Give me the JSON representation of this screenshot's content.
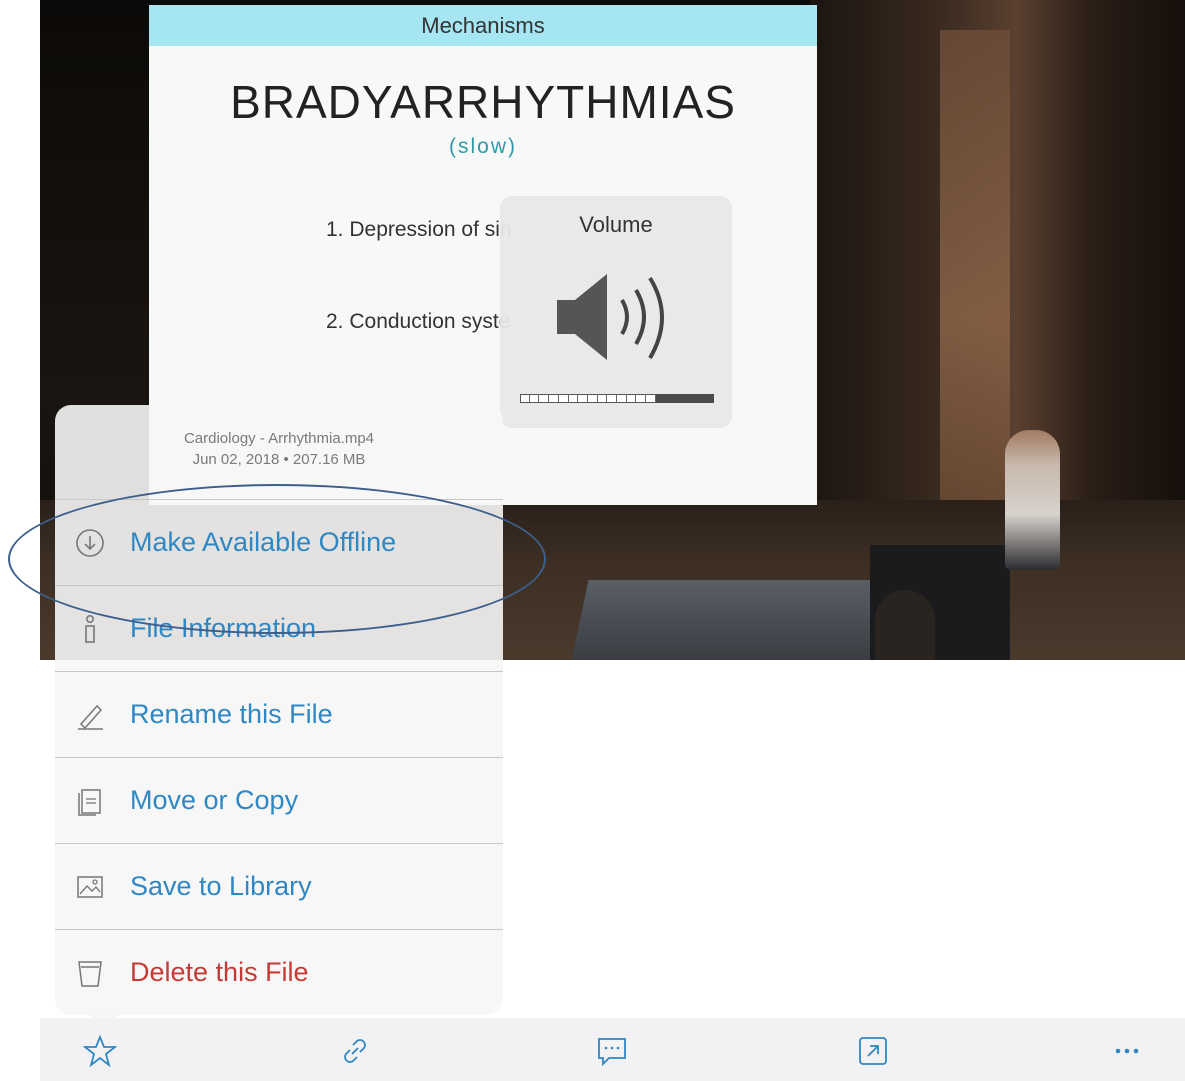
{
  "slide": {
    "header": "Mechanisms",
    "title": "BRADYARRHYTHMIAS",
    "subtitle": "(slow)",
    "items": [
      "1. Depression of sin",
      "2. Conduction syste"
    ]
  },
  "volume_hud": {
    "title": "Volume",
    "level": 0.7,
    "icon": "speaker-icon"
  },
  "file_menu": {
    "filename": "Cardiology - Arrhythmia.mp4",
    "meta": "Jun 02, 2018 • 207.16 MB",
    "items": [
      {
        "label": "Make Available Offline",
        "icon": "download-icon",
        "color": "#2f87c4"
      },
      {
        "label": "File Information",
        "icon": "info-icon",
        "color": "#2f87c4"
      },
      {
        "label": "Rename this File",
        "icon": "pencil-icon",
        "color": "#2f87c4"
      },
      {
        "label": "Move or Copy",
        "icon": "folder-icon",
        "color": "#2f87c4"
      },
      {
        "label": "Save to Library",
        "icon": "image-icon",
        "color": "#2f87c4"
      },
      {
        "label": "Delete this File",
        "icon": "trash-icon",
        "color": "#c53a36"
      }
    ]
  },
  "toolbar": {
    "buttons": [
      "star-icon",
      "link-icon",
      "comment-icon",
      "open-external-icon",
      "more-icon"
    ],
    "accent": "#2f87c4"
  },
  "annotation": {
    "highlight_color": "#3c5f8e",
    "target": "Make Available Offline"
  }
}
